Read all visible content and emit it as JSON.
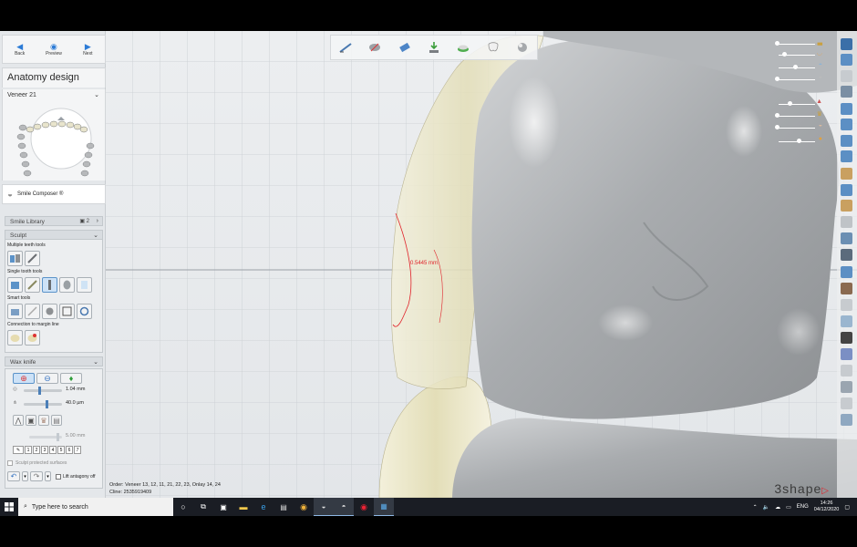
{
  "nav": {
    "back_label": "Back",
    "preview_label": "Preview",
    "next_label": "Next"
  },
  "panel": {
    "title": "Anatomy design",
    "restoration": "Veneer 21",
    "smile_composer": "Smile Composer ®",
    "smile_library": "Smile Library",
    "smile_library_count": "2"
  },
  "sculpt": {
    "header": "Sculpt",
    "multiple_teeth_tools": "Multiple teeth tools",
    "single_tooth_tools": "Single tooth tools",
    "smart_tools": "Smart tools",
    "connection_to_margin_line": "Connection to margin line"
  },
  "wax_knife": {
    "header": "Wax knife",
    "size_value": "1.04 mm",
    "amount_value": "40.0 µm",
    "offset_value": "5.00 mm",
    "numbers": [
      "1",
      "2",
      "3",
      "4",
      "5",
      "6",
      "7"
    ],
    "sculpt_protected": "Sculpt protected surfaces",
    "lift_antagonist": "Lift antagony off"
  },
  "viewport": {
    "measurement": "0.5445 mm"
  },
  "order": {
    "order_line": "Order: Veneer 13, 12, 11, 21, 22, 23, Onlay 14, 24",
    "client_line": "Cline: 2535919409"
  },
  "logo": "3shape",
  "taskbar": {
    "search_placeholder": "Type here to search",
    "language": "ENG",
    "time": "14:26",
    "date": "04/12/2020"
  },
  "colors": {
    "accent": "#2c7bd6",
    "measure": "#e0222a",
    "tooth_gray": "#b9bcbe",
    "wax_yellow": "#ece8c8"
  }
}
